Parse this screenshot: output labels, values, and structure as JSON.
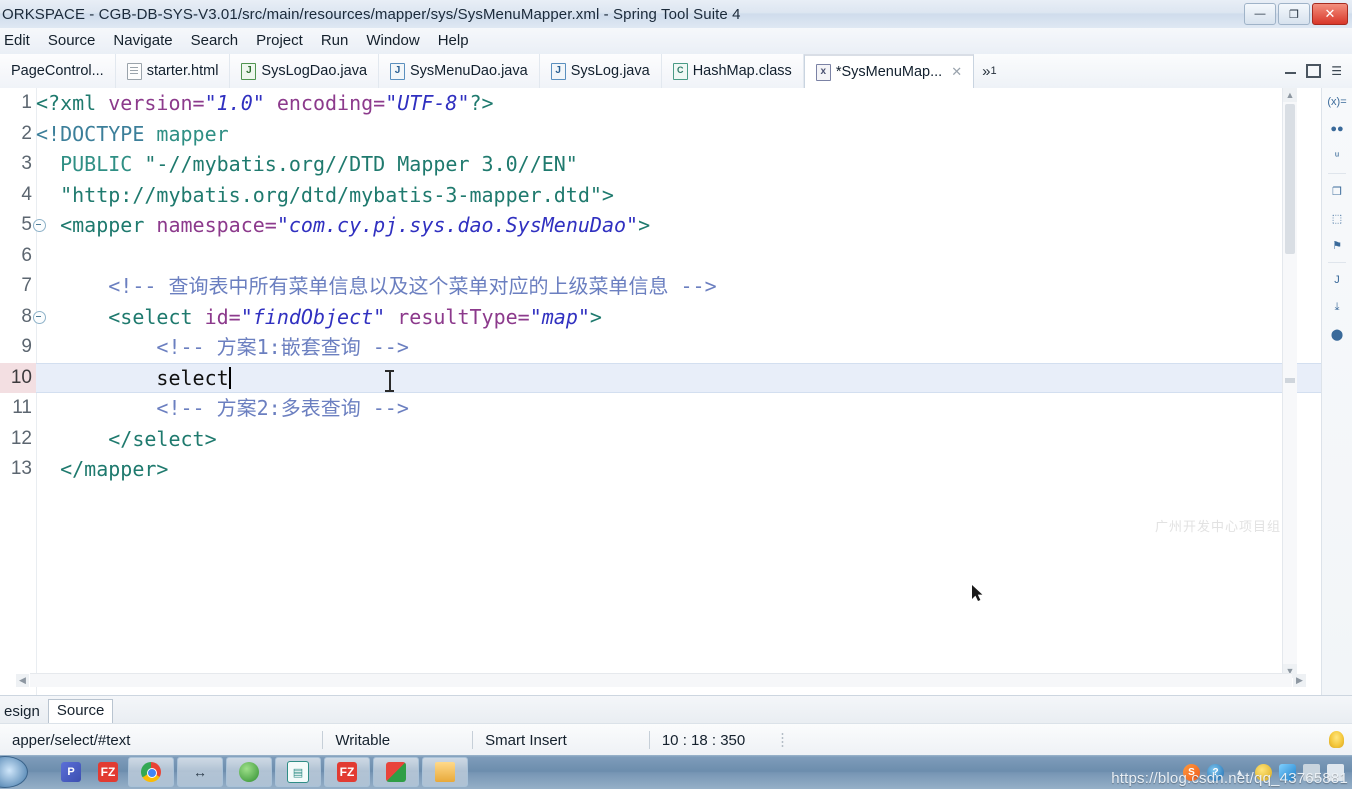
{
  "window": {
    "title": "ORKSPACE - CGB-DB-SYS-V3.01/src/main/resources/mapper/sys/SysMenuMapper.xml - Spring Tool Suite 4",
    "minimize_label": "—",
    "restore_label": "❐",
    "close_label": "✕"
  },
  "menubar": {
    "items": [
      {
        "label": "Edit"
      },
      {
        "label": "Source"
      },
      {
        "label": "Navigate"
      },
      {
        "label": "Search"
      },
      {
        "label": "Project"
      },
      {
        "label": "Run"
      },
      {
        "label": "Window"
      },
      {
        "label": "Help"
      }
    ]
  },
  "editor_tabs": {
    "tabs": [
      {
        "label": "PageControl...",
        "icon": "java-file-icon",
        "icon_kind": "java",
        "active": false,
        "dirty": false
      },
      {
        "label": "starter.html",
        "icon": "html-file-icon",
        "icon_kind": "html",
        "active": false,
        "dirty": false
      },
      {
        "label": "SysLogDao.java",
        "icon": "java-file-icon",
        "icon_kind": "javagreen",
        "active": false,
        "dirty": false
      },
      {
        "label": "SysMenuDao.java",
        "icon": "java-file-icon",
        "icon_kind": "java",
        "active": false,
        "dirty": false
      },
      {
        "label": "SysLog.java",
        "icon": "java-file-icon",
        "icon_kind": "java",
        "active": false,
        "dirty": false
      },
      {
        "label": "HashMap.class",
        "icon": "class-file-icon",
        "icon_kind": "class",
        "active": false,
        "dirty": false
      },
      {
        "label": "*SysMenuMap...",
        "icon": "xml-file-icon",
        "icon_kind": "xml",
        "active": true,
        "dirty": true
      }
    ],
    "close_label": "✕",
    "overflow_label": "»",
    "overflow_count": "1"
  },
  "editor": {
    "current_line": 10,
    "line_numbers": [
      "1",
      "2",
      "3",
      "4",
      "5",
      "6",
      "7",
      "8",
      "9",
      "10",
      "11",
      "12",
      "13"
    ],
    "fold_lines": [
      5,
      8
    ],
    "watermark": "广州开发中心项目组",
    "code_lines": [
      {
        "n": 1,
        "tokens": [
          {
            "t": "<?xml ",
            "c": "s-tag"
          },
          {
            "t": "version=",
            "c": "s-attr"
          },
          {
            "t": "\"1.0\"",
            "c": "s-val"
          },
          {
            "t": " encoding=",
            "c": "s-attr"
          },
          {
            "t": "\"UTF-8\"",
            "c": "s-val"
          },
          {
            "t": "?>",
            "c": "s-tag"
          }
        ]
      },
      {
        "n": 2,
        "tokens": [
          {
            "t": "<!DOCTYPE ",
            "c": "s-bracket"
          },
          {
            "t": "mapper",
            "c": "s-dtdkw"
          }
        ]
      },
      {
        "n": 3,
        "tokens": [
          {
            "t": "  PUBLIC ",
            "c": "s-dtdkw"
          },
          {
            "t": "\"-//mybatis.org//DTD Mapper 3.0//EN\"",
            "c": "s-str"
          }
        ]
      },
      {
        "n": 4,
        "tokens": [
          {
            "t": "  \"http://mybatis.org/dtd/mybatis-3-mapper.dtd\">",
            "c": "s-str"
          }
        ]
      },
      {
        "n": 5,
        "tokens": [
          {
            "t": "  <mapper ",
            "c": "s-tag"
          },
          {
            "t": "namespace=",
            "c": "s-attr"
          },
          {
            "t": "\"com.cy.pj.sys.dao.SysMenuDao\"",
            "c": "s-ns"
          },
          {
            "t": ">",
            "c": "s-tag"
          }
        ]
      },
      {
        "n": 6,
        "tokens": []
      },
      {
        "n": 7,
        "tokens": [
          {
            "t": "      <!-- 查询表中所有菜单信息以及这个菜单对应的上级菜单信息 -->",
            "c": "s-comment"
          }
        ]
      },
      {
        "n": 8,
        "tokens": [
          {
            "t": "      <select ",
            "c": "s-tag"
          },
          {
            "t": "id=",
            "c": "s-attr"
          },
          {
            "t": "\"findObject\"",
            "c": "s-val"
          },
          {
            "t": " resultType=",
            "c": "s-attr"
          },
          {
            "t": "\"map\"",
            "c": "s-val"
          },
          {
            "t": ">",
            "c": "s-tag"
          }
        ]
      },
      {
        "n": 9,
        "tokens": [
          {
            "t": "          <!-- 方案1:嵌套查询 -->",
            "c": "s-comment"
          }
        ]
      },
      {
        "n": 10,
        "tokens": [
          {
            "t": "          select",
            "c": "s-plain"
          }
        ],
        "caret_after": true
      },
      {
        "n": 11,
        "tokens": [
          {
            "t": "          <!-- 方案2:多表查询 -->",
            "c": "s-comment"
          }
        ]
      },
      {
        "n": 12,
        "tokens": [
          {
            "t": "      </select>",
            "c": "s-tag"
          }
        ]
      },
      {
        "n": 13,
        "tokens": [
          {
            "t": "  </mapper>",
            "c": "s-tag"
          }
        ]
      }
    ]
  },
  "rail": {
    "icons": [
      {
        "name": "variables-view-icon",
        "glyph": "(x)="
      },
      {
        "name": "breakpoints-view-icon",
        "glyph": "●●"
      },
      {
        "name": "outline-view-icon",
        "glyph": "ͧͧ"
      },
      {
        "name": "servers-view-icon",
        "glyph": "❐"
      },
      {
        "name": "console-view-icon",
        "glyph": "⬚"
      },
      {
        "name": "problems-view-icon",
        "glyph": "⚑"
      },
      {
        "name": "javadoc-view-icon",
        "glyph": "J"
      },
      {
        "name": "download-view-icon",
        "glyph": "⤓"
      },
      {
        "name": "boot-dashboard-icon",
        "glyph": "⬤"
      }
    ]
  },
  "design_source_tabs": {
    "tabs": [
      {
        "label": "esign",
        "active": false
      },
      {
        "label": "Source",
        "active": true
      }
    ]
  },
  "statusbar": {
    "breadcrumb": "apper/select/#text",
    "writable": "Writable",
    "insert_mode": "Smart Insert",
    "position": "10 : 18 : 350",
    "tip_icon": "lightbulb-icon"
  },
  "taskbar": {
    "start_label": "start-orb",
    "buttons": [
      {
        "name": "taskbar-pycharm",
        "icon": "p-icon",
        "kind": "i-p",
        "glyph": "P",
        "flat": true
      },
      {
        "name": "taskbar-filezilla-pinned",
        "icon": "filezilla-icon",
        "kind": "i-fz",
        "glyph": "FZ",
        "flat": true
      },
      {
        "name": "taskbar-chrome",
        "icon": "chrome-icon",
        "kind": "i-chrome",
        "glyph": "",
        "flat": false
      },
      {
        "name": "taskbar-unknown",
        "icon": "dash-icon",
        "kind": "i-dash",
        "glyph": "↔",
        "flat": false
      },
      {
        "name": "taskbar-green-app",
        "icon": "green-circle-icon",
        "kind": "i-green",
        "glyph": "",
        "flat": false
      },
      {
        "name": "taskbar-editor",
        "icon": "editor-icon",
        "kind": "i-teal",
        "glyph": "▤",
        "flat": false
      },
      {
        "name": "taskbar-filezilla",
        "icon": "filezilla-icon",
        "kind": "i-fz",
        "glyph": "FZ",
        "flat": false
      },
      {
        "name": "taskbar-acrobat",
        "icon": "acrobat-icon",
        "kind": "i-acro",
        "glyph": "",
        "flat": false
      },
      {
        "name": "taskbar-explorer",
        "icon": "folder-icon",
        "kind": "i-folder",
        "glyph": "",
        "flat": false
      }
    ],
    "tray": [
      {
        "name": "tray-sogou",
        "kind": "t-s",
        "glyph": "S"
      },
      {
        "name": "tray-qq",
        "kind": "t-q",
        "glyph": "?"
      },
      {
        "name": "tray-expand-arrow",
        "kind": "t-arrow",
        "glyph": "▴"
      },
      {
        "name": "tray-mail",
        "kind": "t-mail",
        "glyph": ""
      },
      {
        "name": "tray-shield",
        "kind": "t-shield",
        "glyph": ""
      },
      {
        "name": "tray-network",
        "kind": "t-net",
        "glyph": ""
      },
      {
        "name": "tray-volume",
        "kind": "t-vol",
        "glyph": ""
      }
    ],
    "watermark": "https://blog.csdn.net/qq_43765881"
  },
  "colors": {
    "accent": "#3030c0",
    "tag": "#1f7a6e",
    "attr": "#8c3a8c",
    "comment": "#6b7fc0",
    "current_line_bg": "#e8eef9",
    "titlebar": "#dde6f1",
    "taskbar": "#6c8dad"
  }
}
